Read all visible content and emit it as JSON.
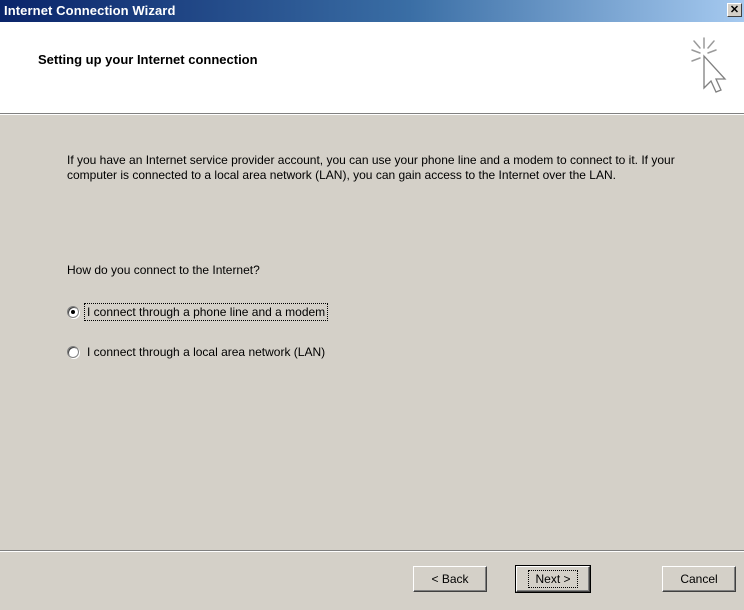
{
  "window": {
    "title": "Internet Connection Wizard",
    "close_glyph": "✕"
  },
  "header": {
    "heading": "Setting up your Internet connection",
    "icon": "wizard-cursor-sparkle-icon"
  },
  "body": {
    "intro": "If you have an Internet service provider account, you can use your phone line and a modem to connect to it. If your computer is connected to a local area network (LAN), you can gain access to the Internet over the LAN.",
    "question": "How do you connect to the Internet?",
    "options": [
      {
        "label": "I connect through a phone line and a modem",
        "selected": true
      },
      {
        "label": "I connect through a local area network (LAN)",
        "selected": false
      }
    ]
  },
  "buttons": {
    "back": "< Back",
    "next": "Next >",
    "cancel": "Cancel"
  },
  "colors": {
    "titlebar_start": "#0a246a",
    "titlebar_end": "#a6caf0",
    "face": "#d4d0c8"
  }
}
